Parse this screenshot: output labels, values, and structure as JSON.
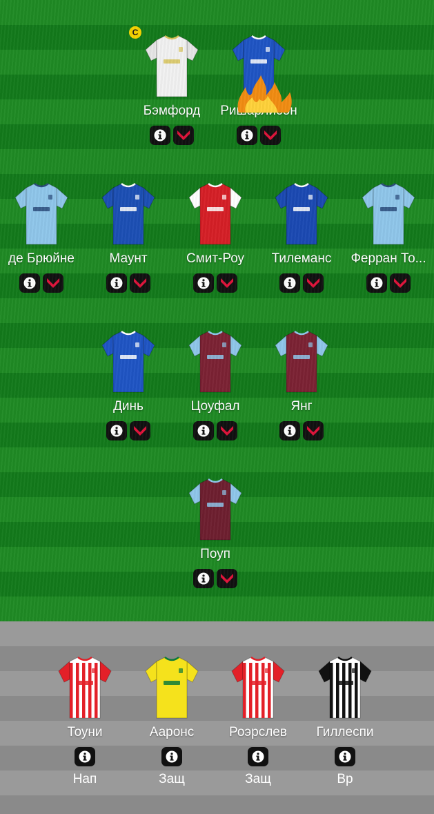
{
  "formation": {
    "forwards": [
      {
        "name": "Бэмфорд",
        "kit": "leeds",
        "captain": true,
        "captain_label": "C"
      },
      {
        "name": "Ришарлисон",
        "kit": "everton",
        "fire": true
      }
    ],
    "midfielders": [
      {
        "name": "де Брюйне",
        "kit": "mancity"
      },
      {
        "name": "Маунт",
        "kit": "chelsea"
      },
      {
        "name": "Смит-Роу",
        "kit": "arsenal"
      },
      {
        "name": "Тилеманс",
        "kit": "leicester"
      },
      {
        "name": "Ферран То...",
        "kit": "mancity"
      }
    ],
    "defenders": [
      {
        "name": "Динь",
        "kit": "everton"
      },
      {
        "name": "Цоуфал",
        "kit": "westham"
      },
      {
        "name": "Янг",
        "kit": "villa"
      }
    ],
    "goalkeeper": [
      {
        "name": "Поуп",
        "kit": "burnley"
      }
    ]
  },
  "bench": [
    {
      "name": "Тоуни",
      "kit": "brentford",
      "position": "Нап"
    },
    {
      "name": "Ааронс",
      "kit": "norwich",
      "position": "Защ"
    },
    {
      "name": "Роэрслев",
      "kit": "brentford",
      "position": "Защ"
    },
    {
      "name": "Гиллеспи",
      "kit": "newcastle",
      "position": "Вр"
    }
  ],
  "icons": {
    "info": "info-icon",
    "expand": "chevron-down-icon",
    "captain": "captain-badge"
  },
  "colors": {
    "pitch_light": "#1f8a24",
    "pitch_dark": "#137a1b",
    "button_bg": "#111111",
    "chevron": "#e0133a",
    "captain": "#f4d200"
  }
}
